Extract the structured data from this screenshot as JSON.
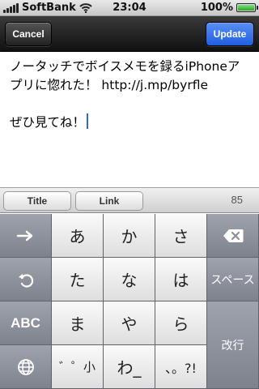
{
  "status_bar": {
    "carrier": "SoftBank",
    "time": "23:04",
    "battery_percent": "100%",
    "battery_level": 1.0
  },
  "nav": {
    "cancel_label": "Cancel",
    "update_label": "Update"
  },
  "compose": {
    "line1": "ノータッチでボイスメモを録るiPhoneアプリに惚れた！ http://j.mp/byrfle",
    "line2": "ぜひ見てね！"
  },
  "toolbar": {
    "title_label": "Title",
    "link_label": "Link",
    "char_count": "85"
  },
  "keyboard": {
    "row1": [
      "あ",
      "か",
      "さ"
    ],
    "row2": [
      "た",
      "な",
      "は"
    ],
    "row3": [
      "ま",
      "や",
      "ら"
    ],
    "row4": [
      "゛゜小",
      "わ_",
      "、。?!"
    ],
    "abc_label": "ABC",
    "space_label": "スペース",
    "return_label": "改行",
    "icons": {
      "next": "arrow-right-icon",
      "undo": "undo-icon",
      "globe": "globe-icon",
      "delete": "delete-icon"
    }
  },
  "colors": {
    "update_button": "#2a6ae8",
    "caret": "#3366dd",
    "keyboard_bg": "#7c8089"
  }
}
